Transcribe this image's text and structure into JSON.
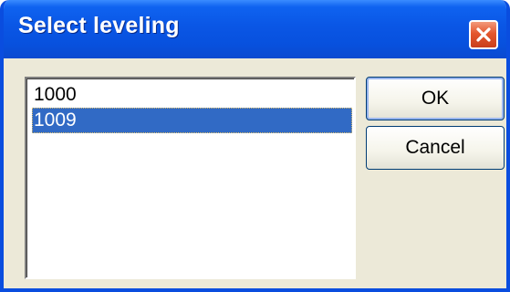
{
  "window": {
    "title": "Select leveling"
  },
  "titlebar": {
    "close_icon": "close-icon"
  },
  "listbox": {
    "items": [
      {
        "label": "1000",
        "selected": false
      },
      {
        "label": "1009",
        "selected": true
      }
    ]
  },
  "buttons": {
    "ok_label": "OK",
    "cancel_label": "Cancel"
  },
  "colors": {
    "titlebar": "#0A56E5",
    "selection": "#316AC5",
    "dialog_face": "#ECE9D8",
    "close_button": "#E4572E"
  }
}
